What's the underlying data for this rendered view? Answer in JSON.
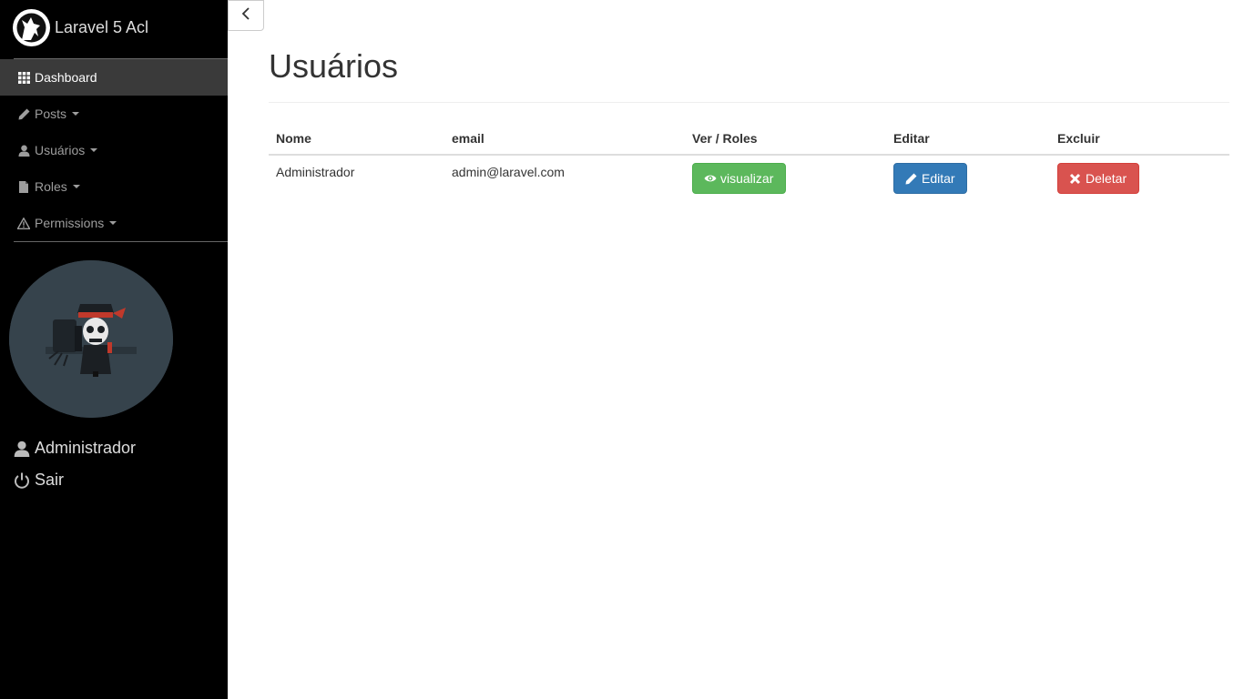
{
  "brand": {
    "title": "Laravel 5 Acl",
    "logo_icon": "wolf-logo-icon"
  },
  "sidebar": {
    "items": [
      {
        "label": "Dashboard",
        "icon": "grid-icon",
        "active": true
      },
      {
        "label": "Posts",
        "icon": "pencil-icon",
        "dropdown": true
      },
      {
        "label": "Usuários",
        "icon": "user-icon",
        "dropdown": true
      },
      {
        "label": "Roles",
        "icon": "file-icon",
        "dropdown": true
      },
      {
        "label": "Permissions",
        "icon": "warning-icon",
        "dropdown": true
      }
    ],
    "user_name": "Administrador",
    "logout_label": "Sair"
  },
  "page": {
    "title": "Usuários"
  },
  "table": {
    "headers": [
      "Nome",
      "email",
      "Ver / Roles",
      "Editar",
      "Excluir"
    ],
    "rows": [
      {
        "name": "Administrador",
        "email": "admin@laravel.com",
        "view_label": "visualizar",
        "edit_label": "Editar",
        "delete_label": "Deletar"
      }
    ]
  },
  "colors": {
    "sidebar_bg": "#000000",
    "success": "#5cb85c",
    "primary": "#337ab7",
    "danger": "#d9534f"
  }
}
